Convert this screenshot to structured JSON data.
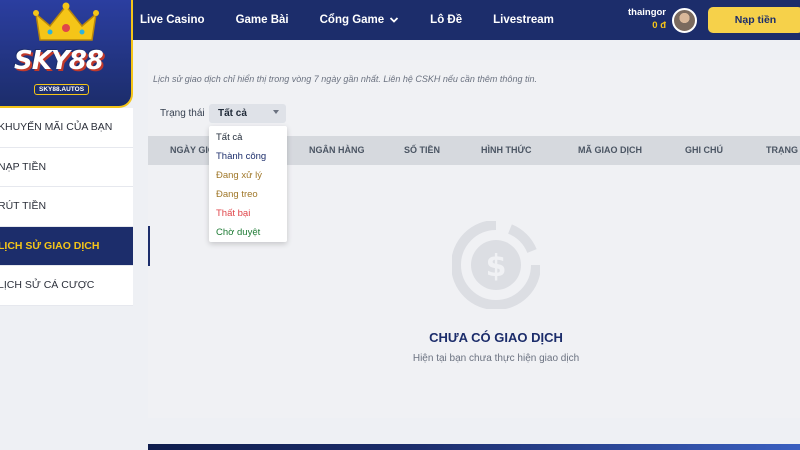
{
  "colors": {
    "navy": "#1c2d6b",
    "gold": "#f5c518",
    "deposit_button": "#f6d14a",
    "success": "#1e7b34",
    "processing": "#a0782a",
    "failed": "#e0454a"
  },
  "logo": {
    "text": "SKY88",
    "subtext": "SKY88.AUTOS",
    "icon": "crown-icon"
  },
  "nav": {
    "items": [
      "Live Casino",
      "Game Bài",
      "Cổng Game",
      "Lô Đề",
      "Livestream"
    ]
  },
  "user": {
    "name": "thaingor",
    "balance": "0 đ"
  },
  "deposit_label": "Nạp tiền",
  "sidebar": {
    "items": [
      {
        "label": "KHUYẾN MÃI CỦA BẠN",
        "active": false
      },
      {
        "label": "NẠP TIỀN",
        "active": false
      },
      {
        "label": "RÚT TIỀN",
        "active": false
      },
      {
        "label": "LỊCH SỬ GIAO DỊCH",
        "active": true
      },
      {
        "label": "LỊCH SỬ CÁ CƯỢC",
        "active": false
      }
    ]
  },
  "main": {
    "note": "Lịch sử giao dịch chỉ hiển thị trong vòng 7 ngày gần nhất. Liên hệ CSKH nếu cần thêm thông tin.",
    "filter": {
      "label": "Trạng thái",
      "selected": "Tất cả",
      "options": [
        "Tất cả",
        "Thành công",
        "Đang xử lý",
        "Đang treo",
        "Thất bại",
        "Chờ duyệt"
      ]
    },
    "table_headers": [
      "NGÀY GIỜ",
      "NGÂN HÀNG",
      "SỐ TIỀN",
      "HÌNH THỨC",
      "MÃ GIAO DỊCH",
      "GHI CHÚ",
      "TRẠNG THÁI"
    ],
    "empty": {
      "icon": "dollar-circle-icon",
      "title": "CHƯA CÓ GIAO DỊCH",
      "subtitle": "Hiện tại bạn chưa thực hiện giao dịch"
    }
  }
}
